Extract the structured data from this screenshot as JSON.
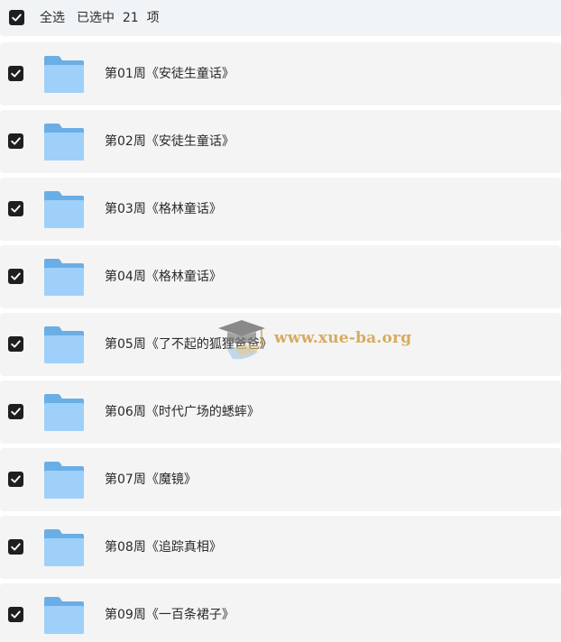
{
  "header": {
    "select_all_label": "全选",
    "selected_summary": "已选中  21  项",
    "checked": true
  },
  "items": [
    {
      "label": "第01周《安徒生童话》",
      "checked": true,
      "icon": "folder-icon"
    },
    {
      "label": "第02周《安徒生童话》",
      "checked": true,
      "icon": "folder-icon"
    },
    {
      "label": "第03周《格林童话》",
      "checked": true,
      "icon": "folder-icon"
    },
    {
      "label": "第04周《格林童话》",
      "checked": true,
      "icon": "folder-icon"
    },
    {
      "label": "第05周《了不起的狐狸爸爸》",
      "checked": true,
      "icon": "folder-icon"
    },
    {
      "label": "第06周《时代广场的蟋蟀》",
      "checked": true,
      "icon": "folder-icon"
    },
    {
      "label": "第07周《魔镜》",
      "checked": true,
      "icon": "folder-icon"
    },
    {
      "label": "第08周《追踪真相》",
      "checked": true,
      "icon": "folder-icon"
    },
    {
      "label": "第09周《一百条裙子》",
      "checked": true,
      "icon": "folder-icon"
    }
  ],
  "watermark": {
    "text": "www.xue-ba.org",
    "icon": "graduation-cap-logo"
  },
  "colors": {
    "checkbox": "#1f1f1f",
    "row_background": "#f4f4f5",
    "header_background": "#f1f4f6",
    "folder_back": "#6aaee6",
    "folder_front": "#9fd0fa",
    "watermark": "#ce9634"
  }
}
